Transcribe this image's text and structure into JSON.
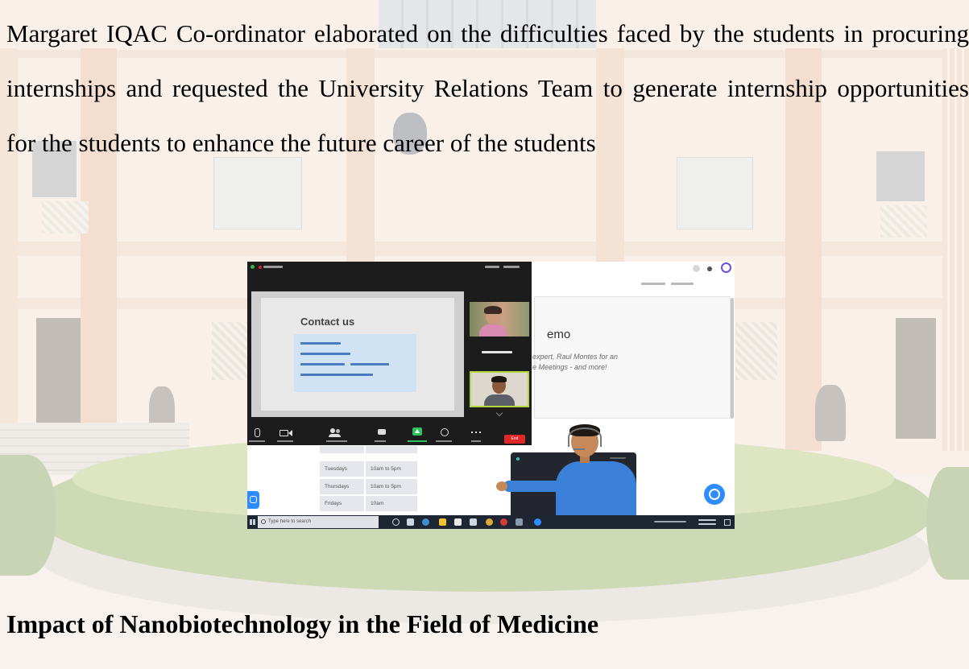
{
  "document": {
    "paragraph": [
      "Margaret IQAC Co-ordinator elaborated on the difficulties faced by the students in procuring",
      "internships and requested the University Relations Team to generate internship opportunities",
      "for the students to enhance the future career of the students"
    ],
    "heading": "Impact of Nanobiotechnology in the Field of Medicine"
  },
  "meeting_screenshot": {
    "zoom": {
      "slide_title": "Contact us",
      "end_button": "End"
    },
    "webpage": {
      "heading_fragment": "emo",
      "tagline": [
        "expert, Raul Montes for an",
        "e Meetings - and more!"
      ],
      "hours": [
        {
          "day": "Tuesdays",
          "time": "10am to 5pm"
        },
        {
          "day": "Thursdays",
          "time": "10am to 5pm"
        },
        {
          "day": "Fridays",
          "time": "10am"
        }
      ]
    },
    "taskbar": {
      "search_placeholder": "Type here to search"
    }
  },
  "colors": {
    "text": "#000000",
    "zoom_background": "#1c1c1c",
    "share_screen_green": "#2ec15f",
    "end_button_red": "#e02828",
    "contact_card_blue": "#cfe3f5",
    "chat_button_blue": "#2d8cff",
    "shirt_blue": "#3a7fd8",
    "hedge_green": "#7ea043"
  }
}
